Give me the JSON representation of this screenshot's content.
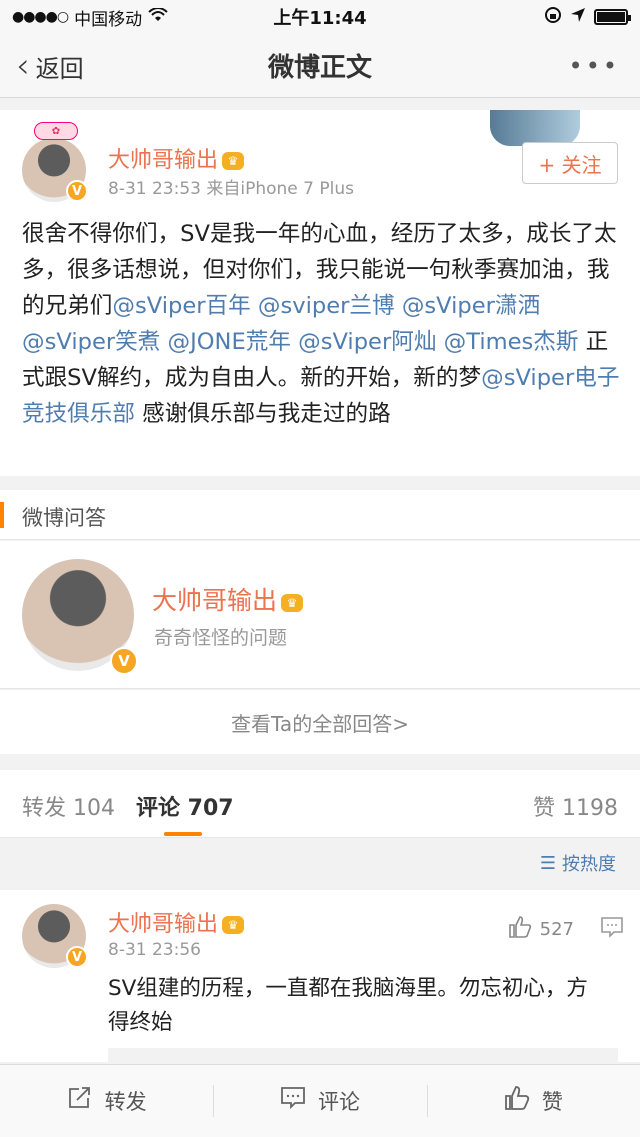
{
  "status_bar": {
    "carrier": "中国移动",
    "time": "上午11:44"
  },
  "nav": {
    "back_label": "返回",
    "title": "微博正文"
  },
  "post": {
    "author": "大帅哥输出",
    "meta": "8-31 23:53  来自iPhone 7 Plus",
    "follow_label": "+ 关注",
    "text_before": "很舍不得你们，SV是我一年的心血，经历了太多，成长了太多，很多话想说，但对你们，我只能说一句秋季赛加油，我的兄弟们",
    "mention_1": "@sViper百年",
    "mention_2": "@sviper兰博",
    "mention_3": "@sViper潇洒",
    "mention_4": "@sViper笑煮",
    "mention_5": "@JONE荒年",
    "mention_6": "@sViper阿灿",
    "mention_7": "@Times杰斯",
    "text_middle": " 正式跟SV解约，成为自由人。新的开始，新的梦",
    "mention_8": "@sViper电子竞技俱乐部",
    "text_after": " 感谢俱乐部与我走过的路"
  },
  "qa": {
    "section_title": "微博问答",
    "name": "大帅哥输出",
    "subtitle": "奇奇怪怪的问题",
    "view_all": "查看Ta的全部回答>"
  },
  "tabs": {
    "repost_label": "转发 104",
    "comment_label": "评论 707",
    "like_label": "赞 1198"
  },
  "sort": {
    "label": "按热度"
  },
  "comment": {
    "author": "大帅哥输出",
    "time": "8-31 23:56",
    "likes": "527",
    "text": "SV组建的历程，一直都在我脑海里。勿忘初心，方得终始"
  },
  "toolbar": {
    "repost": "转发",
    "comment": "评论",
    "like": "赞"
  },
  "colors": {
    "accent": "#ff8200",
    "username": "#eb7350",
    "link": "#507daf"
  }
}
